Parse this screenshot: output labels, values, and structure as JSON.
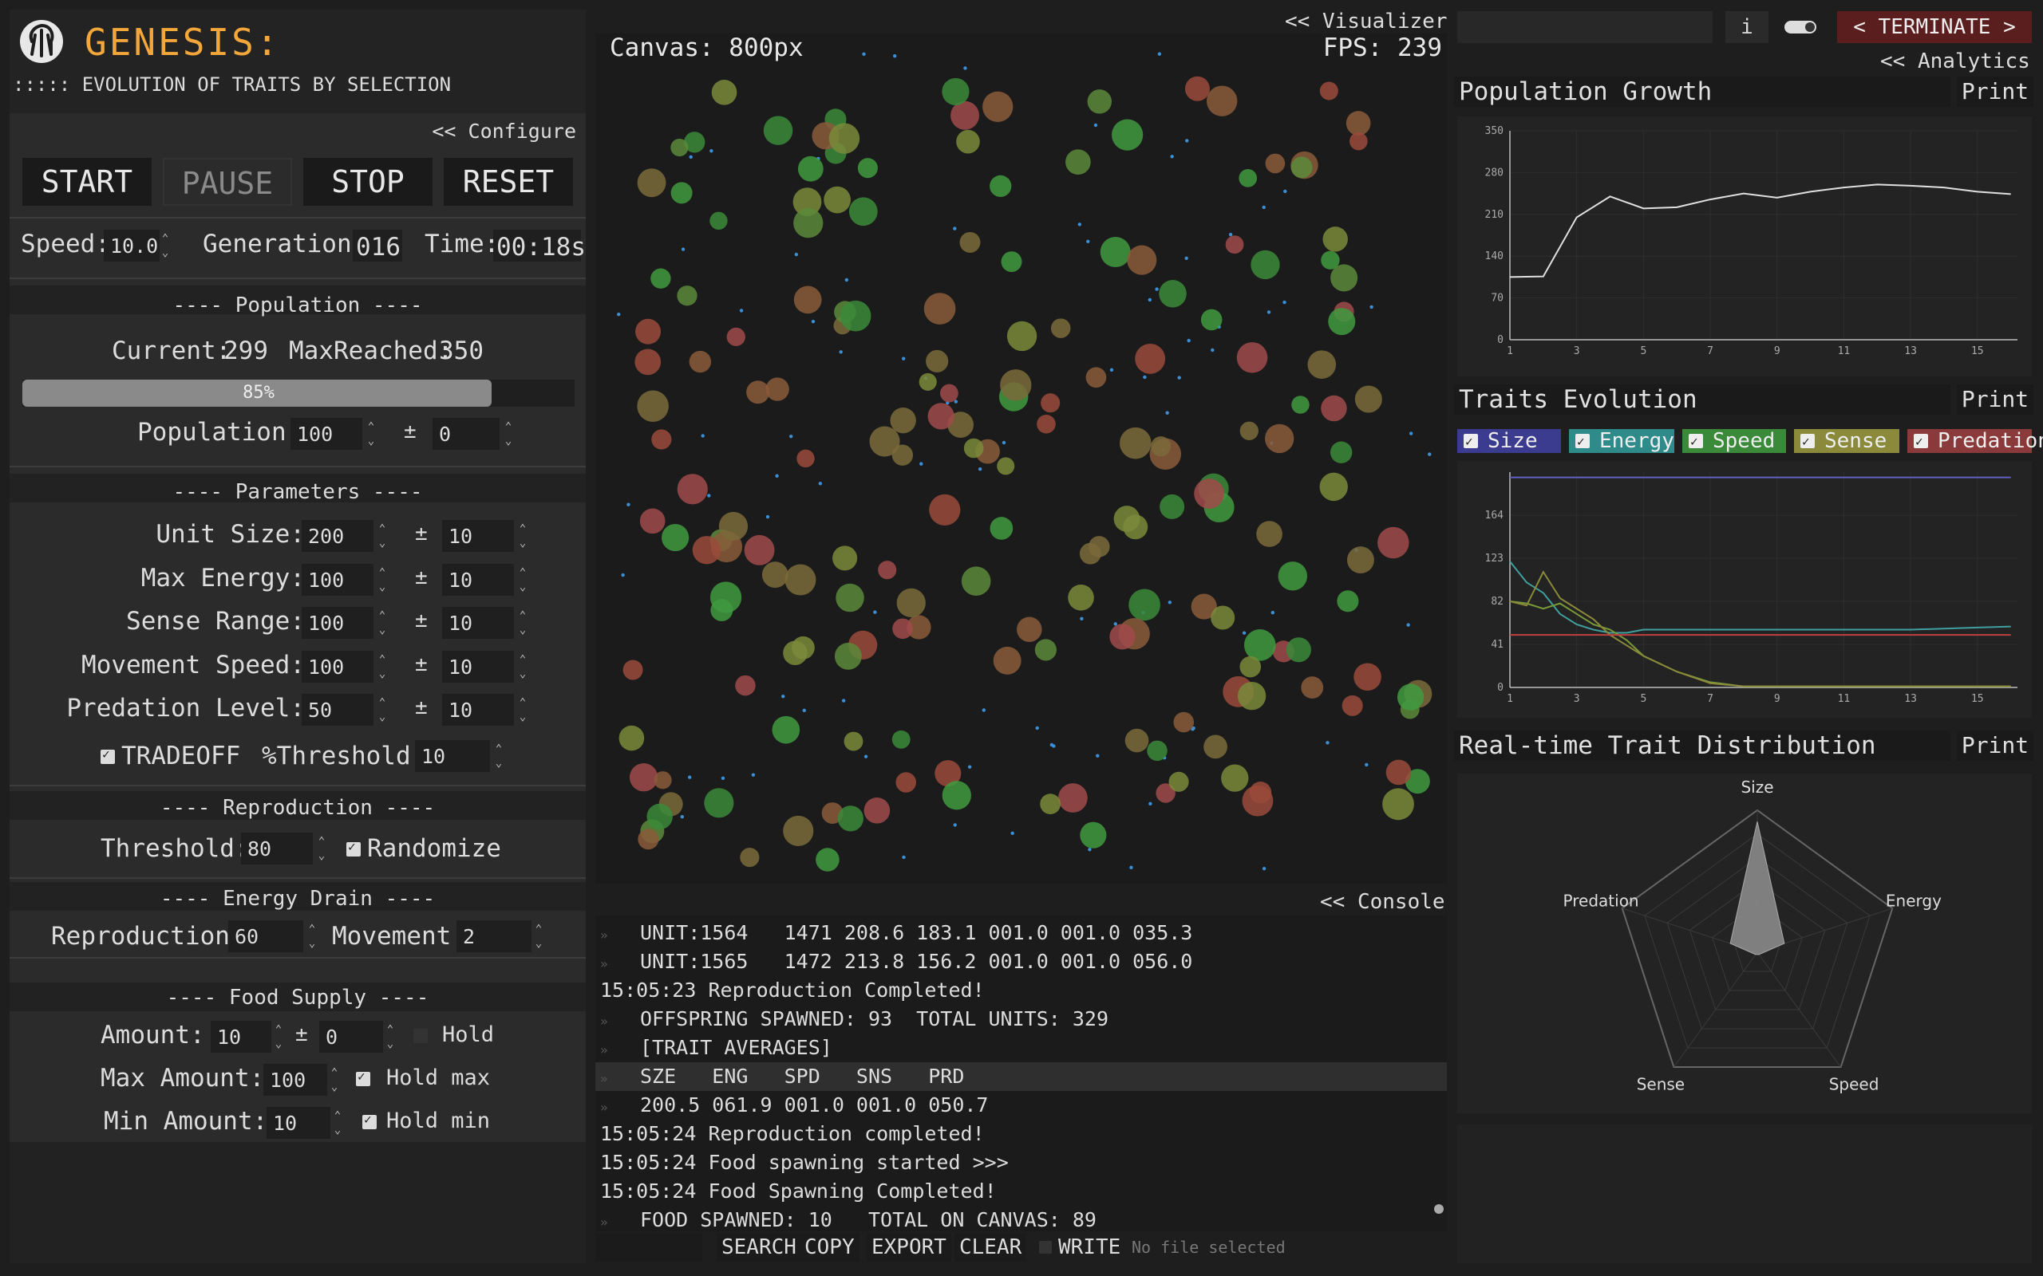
{
  "app": {
    "title": "GENESIS:",
    "subtitle": "::::: EVOLUTION OF TRAITS BY SELECTION",
    "configure_link": "<< Configure",
    "visualizer_link": "<< Visualizer",
    "console_link": "<< Console",
    "analytics_link": "<< Analytics",
    "terminate_label": "< TERMINATE >",
    "info_label": "i"
  },
  "controls": {
    "start": "START",
    "pause": "PAUSE",
    "stop": "STOP",
    "reset": "RESET"
  },
  "status": {
    "speed_label": "Speed:",
    "speed_value": "10.0",
    "generation_label": "Generation:",
    "generation_value": "016",
    "time_label": "Time:",
    "time_value": "00:18s"
  },
  "population": {
    "section_title": "---- Population ----",
    "current_label": "Current:",
    "current_value": "299",
    "max_label": "MaxReached:",
    "max_value": "350",
    "progress_text": "85%",
    "progress_fraction": 0.85,
    "population_label": "Population:",
    "population_value": "100",
    "pm": "±",
    "population_var": "0"
  },
  "parameters": {
    "section_title": "---- Parameters ----",
    "rows": [
      {
        "label": "Unit Size:",
        "value": "200",
        "pm": "±",
        "var": "10"
      },
      {
        "label": "Max Energy:",
        "value": "100",
        "pm": "±",
        "var": "10"
      },
      {
        "label": "Sense Range:",
        "value": "100",
        "pm": "±",
        "var": "10"
      },
      {
        "label": "Movement Speed:",
        "value": "100",
        "pm": "±",
        "var": "10"
      },
      {
        "label": "Predation Level:",
        "value": "50",
        "pm": "±",
        "var": "10"
      }
    ],
    "tradeoff_label": "TRADEOFF",
    "threshold_label": "%Threshold:",
    "threshold_value": "10"
  },
  "reproduction": {
    "section_title": "---- Reproduction ----",
    "threshold_label": "Threshold:",
    "threshold_value": "80",
    "randomize_label": "Randomize"
  },
  "energy_drain": {
    "section_title": "---- Energy Drain ----",
    "reproduction_label": "Reproduction:",
    "reproduction_value": "60",
    "movement_label": "Movement:",
    "movement_value": "2"
  },
  "food_supply": {
    "section_title": "---- Food Supply ----",
    "amount_label": "Amount:",
    "amount_value": "10",
    "pm": "±",
    "amount_var": "0",
    "hold_label": "Hold",
    "max_label": "Max Amount:",
    "max_value": "100",
    "hold_max_label": "Hold max",
    "min_label": "Min Amount:",
    "min_value": "10",
    "hold_min_label": "Hold min"
  },
  "visualizer": {
    "canvas_label": "Canvas: 800px",
    "fps_label": "FPS: 239"
  },
  "console": {
    "lines": [
      {
        "arrow": true,
        "text": "UNIT:1564   1471 208.6 183.1 001.0 001.0 035.3"
      },
      {
        "arrow": true,
        "text": "UNIT:1565   1472 213.8 156.2 001.0 001.0 056.0"
      },
      {
        "arrow": false,
        "text": "15:05:23 Reproduction Completed!"
      },
      {
        "arrow": true,
        "text": "OFFSPRING SPAWNED: 93  TOTAL UNITS: 329"
      },
      {
        "arrow": true,
        "text": "[TRAIT AVERAGES]"
      },
      {
        "arrow": true,
        "text": "SZE   ENG   SPD   SNS   PRD",
        "highlight": true
      },
      {
        "arrow": true,
        "text": "200.5 061.9 001.0 001.0 050.7"
      },
      {
        "arrow": false,
        "text": "15:05:24 Reproduction completed!"
      },
      {
        "arrow": false,
        "text": "15:05:24 Food spawning started >>>"
      },
      {
        "arrow": false,
        "text": "15:05:24 Food Spawning Completed!"
      },
      {
        "arrow": true,
        "text": "FOOD SPAWNED: 10   TOTAL ON CANVAS: 89"
      }
    ],
    "search": "SEARCH",
    "copy": "COPY",
    "export": "EXPORT",
    "clear": "CLEAR",
    "write": "WRITE",
    "file_status": "No file selected"
  },
  "analytics": {
    "population_title": "Population Growth",
    "traits_title": "Traits Evolution",
    "distribution_title": "Real-time Trait Distribution",
    "print": "Print",
    "trait_toggles": [
      {
        "label": "Size",
        "color": "#3b3b8f"
      },
      {
        "label": "Energy",
        "color": "#2f8a8a"
      },
      {
        "label": "Speed",
        "color": "#3a8a3a"
      },
      {
        "label": "Sense",
        "color": "#8a8a3a"
      },
      {
        "label": "Predation",
        "color": "#8a3a3a"
      }
    ]
  },
  "chart_data": [
    {
      "type": "line",
      "title": "Population Growth",
      "x": [
        1,
        2,
        3,
        4,
        5,
        6,
        7,
        8,
        9,
        10,
        11,
        12,
        13,
        14,
        15,
        16
      ],
      "series": [
        {
          "values": [
            105,
            106,
            205,
            240,
            220,
            222,
            235,
            245,
            238,
            248,
            255,
            260,
            258,
            255,
            248,
            244
          ]
        }
      ],
      "xticks": [
        1,
        3,
        5,
        7,
        9,
        11,
        13,
        15
      ],
      "yticks": [
        0,
        70,
        140,
        210,
        280,
        350
      ],
      "ylim": [
        0,
        350
      ],
      "color": "#e0e0e0"
    },
    {
      "type": "line",
      "title": "Traits Evolution",
      "x": [
        1,
        1.5,
        2,
        2.5,
        3,
        3.5,
        4,
        4.5,
        5,
        6,
        7,
        8,
        9,
        10,
        11,
        12,
        13,
        14,
        15,
        16
      ],
      "series": [
        {
          "name": "Size",
          "color": "#6060c0",
          "values": [
            200,
            200,
            200,
            200,
            200,
            200,
            200,
            200,
            200,
            200,
            200,
            200,
            200,
            200,
            200,
            200,
            200,
            200,
            200,
            200
          ]
        },
        {
          "name": "Energy",
          "color": "#40a0a0",
          "values": [
            120,
            100,
            90,
            70,
            60,
            55,
            52,
            52,
            55,
            55,
            55,
            55,
            55,
            55,
            55,
            55,
            55,
            56,
            57,
            58
          ]
        },
        {
          "name": "Speed",
          "color": "#7a9a3a",
          "values": [
            82,
            80,
            75,
            80,
            70,
            60,
            55,
            45,
            30,
            15,
            5,
            1,
            1,
            1,
            1,
            1,
            1,
            1,
            1,
            1
          ]
        },
        {
          "name": "Sense",
          "color": "#8a8a3a",
          "values": [
            82,
            78,
            110,
            85,
            75,
            65,
            50,
            40,
            30,
            15,
            4,
            1,
            1,
            1,
            1,
            1,
            1,
            1,
            1,
            1
          ]
        },
        {
          "name": "Predation",
          "color": "#c04040",
          "values": [
            50,
            50,
            50,
            50,
            50,
            50,
            50,
            50,
            50,
            50,
            50,
            50,
            50,
            50,
            50,
            50,
            50,
            50,
            50,
            50
          ]
        }
      ],
      "xticks": [
        1,
        3,
        5,
        7,
        9,
        11,
        13,
        15
      ],
      "yticks": [
        0,
        41,
        82,
        123,
        164
      ],
      "ylim": [
        0,
        205
      ]
    },
    {
      "type": "radar",
      "title": "Real-time Trait Distribution",
      "axes": [
        "Size",
        "Energy",
        "Speed",
        "Sense",
        "Predation"
      ],
      "values": [
        0.92,
        0.2,
        0.02,
        0.02,
        0.2
      ],
      "fill": "#8a8a8a"
    }
  ]
}
